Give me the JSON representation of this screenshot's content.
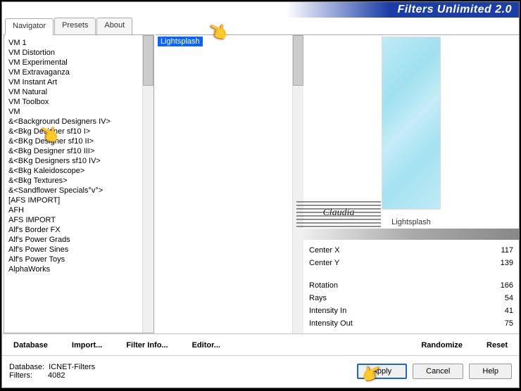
{
  "title": "Filters Unlimited 2.0",
  "tabs": {
    "navigator": "Navigator",
    "presets": "Presets",
    "about": "About"
  },
  "categories": [
    "VM 1",
    "VM Distortion",
    "VM Experimental",
    "VM Extravaganza",
    "VM Instant Art",
    "VM Natural",
    "VM Toolbox",
    "VM",
    "&<Background Designers IV>",
    "&<Bkg Designer sf10 I>",
    "&<BKg Designer sf10 II>",
    "&<Bkg Designer sf10 III>",
    "&<BKg Designers sf10 IV>",
    "&<Bkg Kaleidoscope>",
    "&<Bkg Textures>",
    "&<Sandflower Specials°v°>",
    "[AFS IMPORT]",
    "AFH",
    "AFS IMPORT",
    "Alf's Border FX",
    "Alf's Power Grads",
    "Alf's Power Sines",
    "Alf's Power Toys",
    "AlphaWorks"
  ],
  "filter_selected": "Lightsplash",
  "preview_label": "Lightsplash",
  "params": [
    {
      "name": "Center X",
      "value": "117"
    },
    {
      "name": "Center Y",
      "value": "139"
    },
    {
      "name": "Rotation",
      "value": "166"
    },
    {
      "name": "Rays",
      "value": "54"
    },
    {
      "name": "Intensity In",
      "value": "41"
    },
    {
      "name": "Intensity Out",
      "value": "75"
    }
  ],
  "toolbar": {
    "database": "Database",
    "import": "Import...",
    "filter_info": "Filter Info...",
    "editor": "Editor...",
    "randomize": "Randomize",
    "reset": "Reset"
  },
  "footer": {
    "db_label": "Database:",
    "db_value": "ICNET-Filters",
    "filters_label": "Filters:",
    "filters_value": "4082"
  },
  "buttons": {
    "apply": "Apply",
    "cancel": "Cancel",
    "help": "Help"
  },
  "stamp": "Claudia"
}
